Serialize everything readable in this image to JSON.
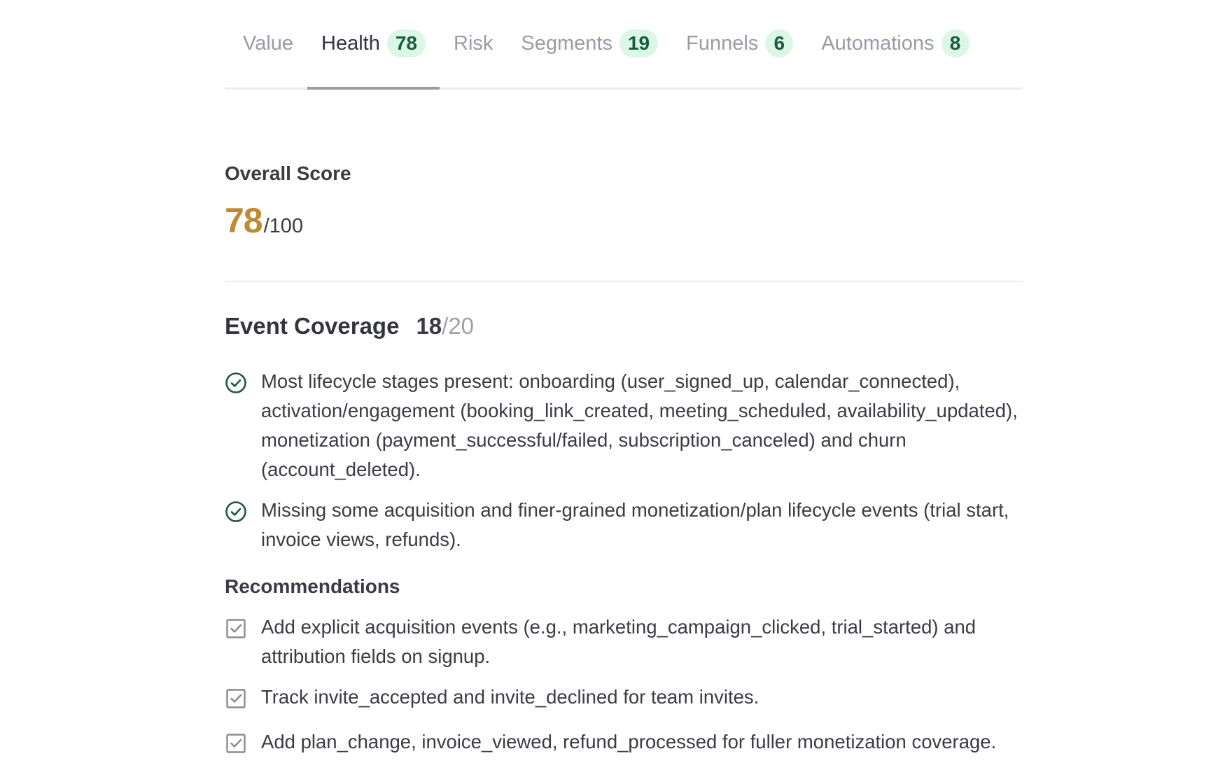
{
  "tabs": [
    {
      "label": "Value",
      "badge": null,
      "active": false
    },
    {
      "label": "Health",
      "badge": "78",
      "active": true
    },
    {
      "label": "Risk",
      "badge": null,
      "active": false
    },
    {
      "label": "Segments",
      "badge": "19",
      "active": false
    },
    {
      "label": "Funnels",
      "badge": "6",
      "active": false
    },
    {
      "label": "Automations",
      "badge": "8",
      "active": false
    }
  ],
  "overall": {
    "label": "Overall Score",
    "score": "78",
    "max": "/100"
  },
  "coverage": {
    "title": "Event Coverage",
    "score": "18",
    "total": "/20",
    "findings": [
      "Most lifecycle stages present: onboarding (user_signed_up, calendar_connected), activation/engagement (booking_link_created, meeting_scheduled, availability_updated), monetization (payment_successful/failed, subscription_canceled) and churn (account_deleted).",
      "Missing some acquisition and finer-grained monetization/plan lifecycle events (trial start, invoice views, refunds)."
    ],
    "recommendations_title": "Recommendations",
    "recommendations": [
      "Add explicit acquisition events (e.g., marketing_campaign_clicked, trial_started) and attribution fields on signup.",
      "Track invite_accepted and invite_declined for team invites.",
      "Add plan_change, invoice_viewed, refund_processed for fuller monetization coverage."
    ]
  },
  "colors": {
    "accent_score": "#c08a32",
    "badge_bg": "#dcf7e6",
    "badge_text": "#175c3b",
    "check_icon": "#1e5a3c"
  },
  "icons": {
    "finding": "check-circle-icon",
    "recommendation": "checkbox-checked-icon"
  }
}
